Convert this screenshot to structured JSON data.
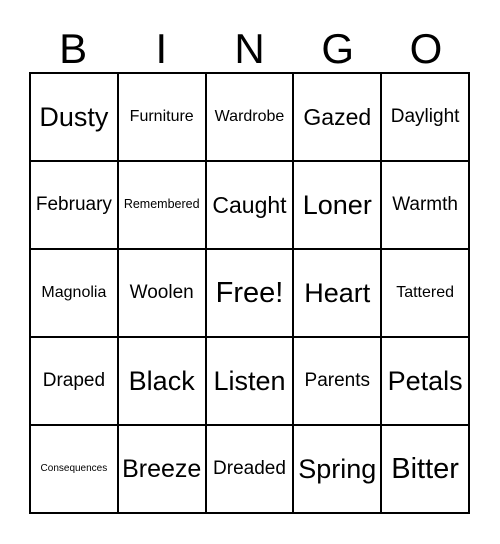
{
  "card": {
    "title": "BINGO",
    "header_letters": [
      "B",
      "I",
      "N",
      "G",
      "O"
    ],
    "columns": 5,
    "rows": 5,
    "border_color": "#000000",
    "background_color": "#ffffff",
    "text_color": "#000000",
    "rows_data": [
      [
        {
          "label": "Dusty",
          "size": "s-xxl",
          "free": false
        },
        {
          "label": "Furniture",
          "size": "s-md",
          "free": false
        },
        {
          "label": "Wardrobe",
          "size": "s-md",
          "free": false
        },
        {
          "label": "Gazed",
          "size": "s-xl",
          "free": false
        },
        {
          "label": "Daylight",
          "size": "s-lg",
          "free": false
        }
      ],
      [
        {
          "label": "February",
          "size": "s-lg",
          "free": false
        },
        {
          "label": "Remembered",
          "size": "s-sm",
          "free": false
        },
        {
          "label": "Caught",
          "size": "s-xl",
          "free": false
        },
        {
          "label": "Loner",
          "size": "s-xxl",
          "free": false
        },
        {
          "label": "Warmth",
          "size": "s-lg",
          "free": false
        }
      ],
      [
        {
          "label": "Magnolia",
          "size": "s-md",
          "free": false
        },
        {
          "label": "Woolen",
          "size": "s-lg",
          "free": false
        },
        {
          "label": "Free!",
          "size": "s-free",
          "free": true
        },
        {
          "label": "Heart",
          "size": "s-xxl",
          "free": false
        },
        {
          "label": "Tattered",
          "size": "s-md",
          "free": false
        }
      ],
      [
        {
          "label": "Draped",
          "size": "s-lg",
          "free": false
        },
        {
          "label": "Black",
          "size": "s-xxl",
          "free": false
        },
        {
          "label": "Listen",
          "size": "s-xxl",
          "free": false
        },
        {
          "label": "Parents",
          "size": "s-lg",
          "free": false
        },
        {
          "label": "Petals",
          "size": "s-xxl",
          "free": false
        }
      ],
      [
        {
          "label": "Consequences",
          "size": "s-xs",
          "free": false
        },
        {
          "label": "Breeze",
          "size": "s-xxl",
          "free": false
        },
        {
          "label": "Dreaded",
          "size": "s-lg",
          "free": false
        },
        {
          "label": "Spring",
          "size": "s-xxl",
          "free": false
        },
        {
          "label": "Bitter",
          "size": "s-free",
          "free": false
        }
      ]
    ]
  }
}
